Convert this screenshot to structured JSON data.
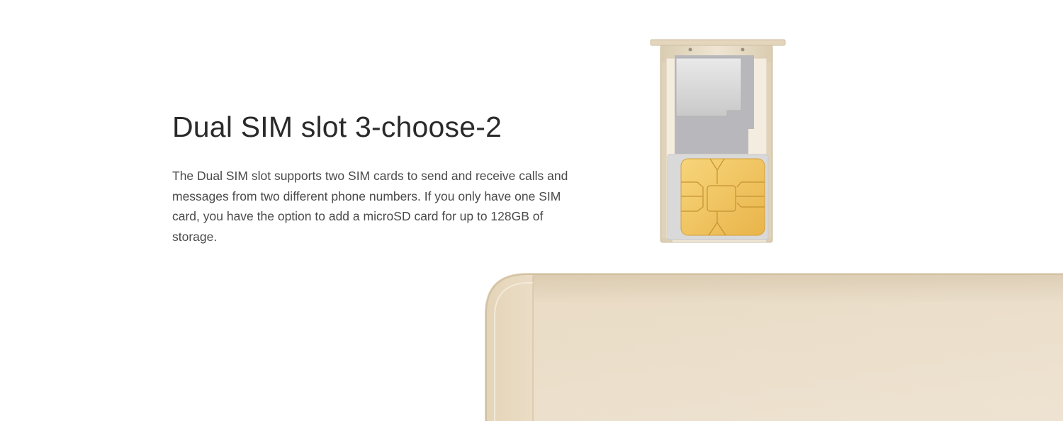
{
  "feature": {
    "title": "Dual SIM slot 3-choose-2",
    "description": "The Dual SIM slot supports two SIM cards to send and receive calls and messages from two different phone numbers. If you only have one SIM card, you have the option to add a microSD card for up to 128GB of storage."
  },
  "colors": {
    "background": "#ffffff",
    "title": "#2a2a2a",
    "body": "#4a4a4a",
    "tray_gold": "#e8dcc4",
    "sim_gold": "#f2c25a",
    "phone_gold": "#e9dcc6"
  },
  "illustrations": {
    "tray": "sim-tray-icon",
    "phone": "phone-corner-image"
  }
}
